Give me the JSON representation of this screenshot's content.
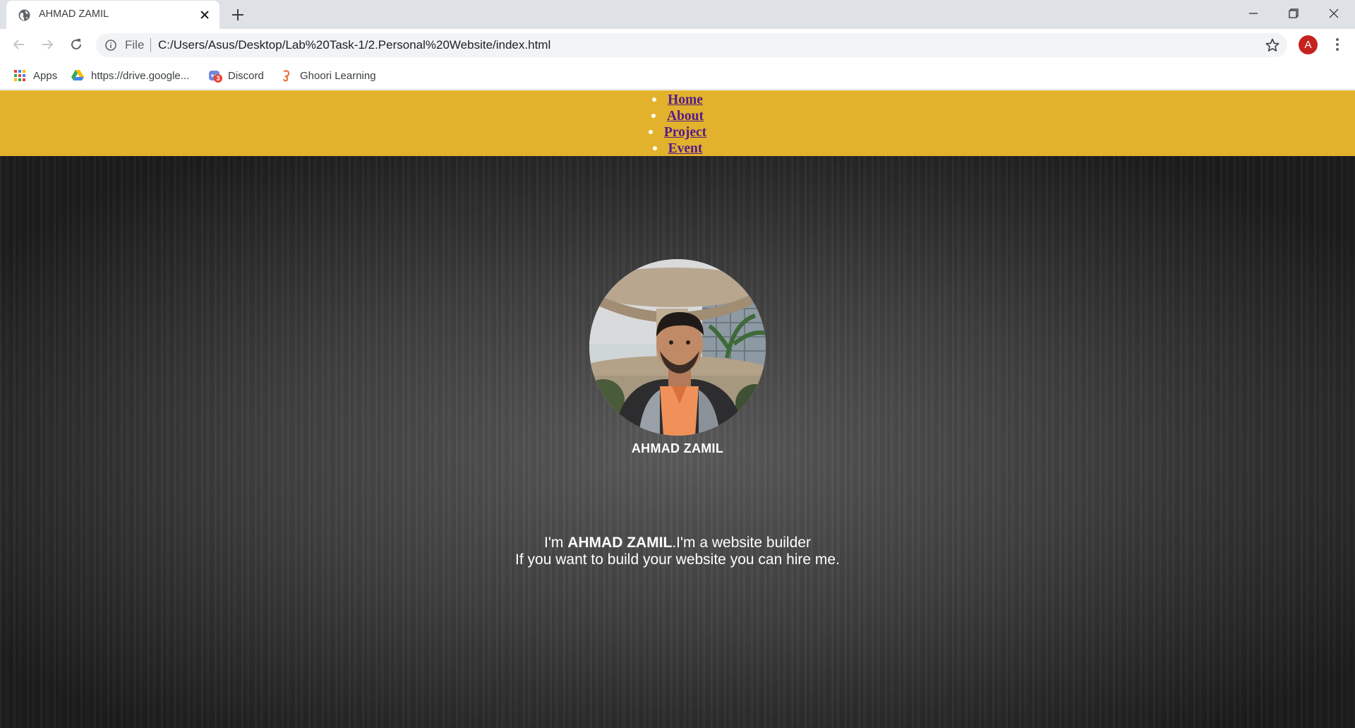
{
  "browser": {
    "tab": {
      "title": "AHMAD ZAMIL"
    },
    "address": {
      "scheme_label": "File",
      "url": "C:/Users/Asus/Desktop/Lab%20Task-1/2.Personal%20Website/index.html"
    },
    "profile_initial": "A",
    "bookmarks": [
      {
        "label": "Apps",
        "icon": "apps-grid-icon"
      },
      {
        "label": "https://drive.google...",
        "icon": "google-drive-icon"
      },
      {
        "label": "Discord",
        "icon": "discord-icon",
        "badge": "3"
      },
      {
        "label": "Ghoori Learning",
        "icon": "ghoori-learning-icon"
      }
    ]
  },
  "site": {
    "nav": [
      "Home",
      "About",
      "Project",
      "Event"
    ],
    "name": "AHMAD ZAMIL",
    "intro": {
      "prefix": "I'm ",
      "highlight": "AHMAD ZAMIL",
      "suffix": ".I'm a website builder",
      "line2": "If you want to build your website you can hire me."
    },
    "colors": {
      "nav_background": "#e2b22c",
      "link": "#551a8b",
      "hero_background": "#2e2e2e",
      "text": "#ffffff"
    }
  }
}
